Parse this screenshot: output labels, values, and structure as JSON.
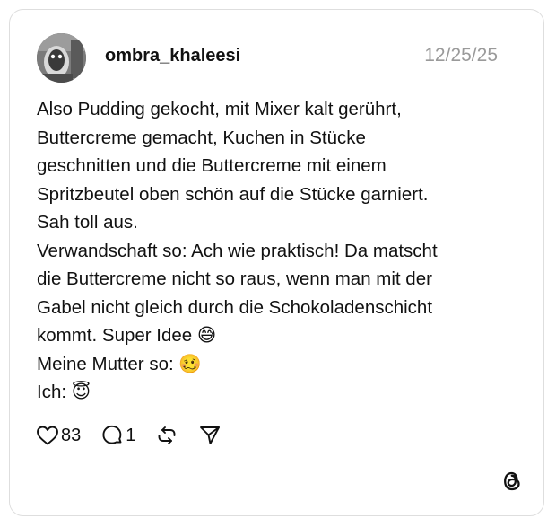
{
  "post": {
    "username": "ombra_khaleesi",
    "date": "12/25/25",
    "lines": [
      "Also Pudding gekocht, mit Mixer kalt gerührt,",
      "Buttercreme gemacht, Kuchen in Stücke",
      "geschnitten und die Buttercreme mit einem",
      "Spritzbeutel oben schön auf die Stücke garniert.",
      "Sah toll aus.",
      "Verwandschaft so: Ach wie praktisch! Da matscht",
      "die Buttercreme nicht so raus, wenn man mit der",
      "Gabel nicht gleich durch die Schokoladenschicht",
      "kommt. Super Idee 😅",
      "Meine Mutter so: 🥴",
      "Ich: 😇"
    ]
  },
  "actions": {
    "likes": "83",
    "replies": "1"
  },
  "icons": [
    "heart-icon",
    "comment-icon",
    "repost-icon",
    "share-icon",
    "threads-logo-icon"
  ],
  "colors": {
    "border": "#dedede",
    "date": "#9a9a9a",
    "text": "#111111"
  }
}
